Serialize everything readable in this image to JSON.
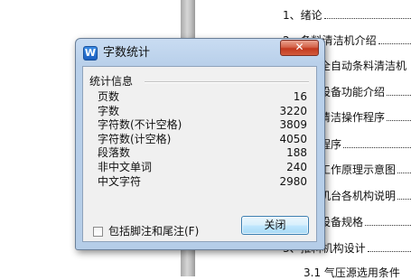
{
  "document": {
    "toc_lines": [
      {
        "text": "1、绪论"
      },
      {
        "text": "2、条料清洁机介绍"
      },
      {
        "text": "全自动条料清洁机"
      },
      {
        "text": "设备功能介绍"
      },
      {
        "text": "清洁操作程序"
      },
      {
        "text": "程序"
      },
      {
        "text": "工作原理示意图"
      },
      {
        "text": "机台各机构说明"
      },
      {
        "text": "设备规格"
      },
      {
        "text": "3、推料机构设计"
      },
      {
        "text": "3.1 气压源选用条件"
      }
    ]
  },
  "dialog": {
    "title": "字数统计",
    "app_icon_glyph": "W",
    "close_glyph": "✕",
    "group_title": "统计信息",
    "stats": [
      {
        "label": "页数",
        "value": "16"
      },
      {
        "label": "字数",
        "value": "3220"
      },
      {
        "label": "字符数(不计空格)",
        "value": "3809"
      },
      {
        "label": "字符数(计空格)",
        "value": "4050"
      },
      {
        "label": "段落数",
        "value": "188"
      },
      {
        "label": "非中文单词",
        "value": "240"
      },
      {
        "label": "中文字符",
        "value": "2980"
      }
    ],
    "checkbox": {
      "label": "包括脚注和尾注(F)",
      "checked": false
    },
    "close_button_label": "关闭"
  }
}
